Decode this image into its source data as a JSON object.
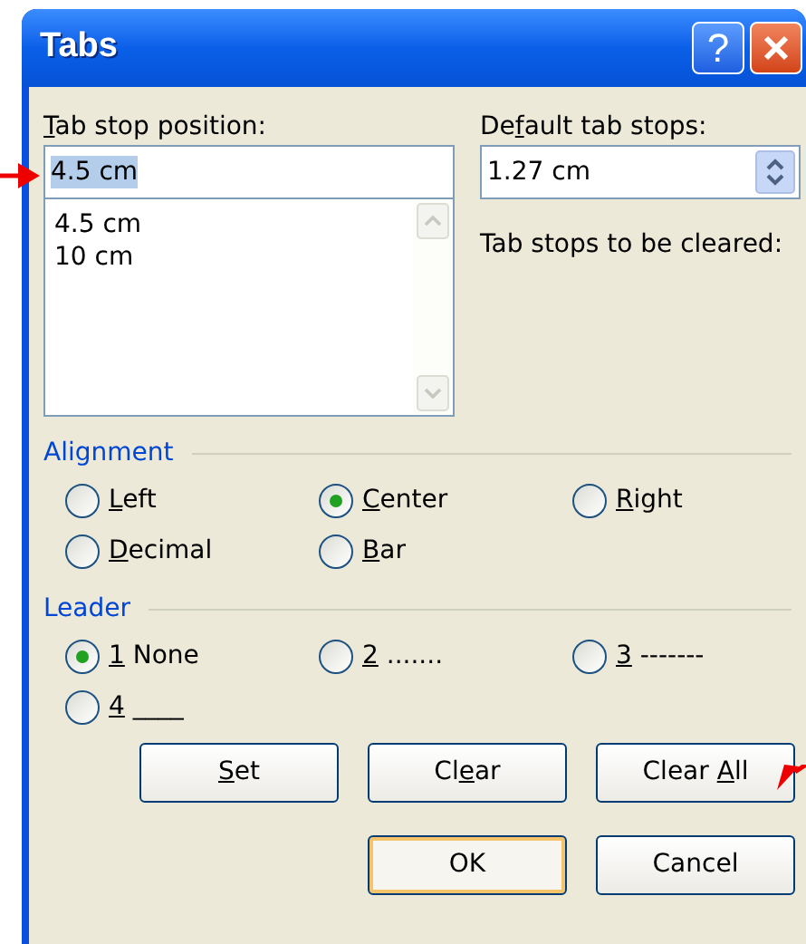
{
  "window": {
    "title": "Tabs",
    "buttons": [
      {
        "kind": "help",
        "label": "?"
      },
      {
        "kind": "close"
      }
    ]
  },
  "tab_stop_position": {
    "label": {
      "key": "T",
      "post": "ab stop position:"
    },
    "value": "4.5 cm",
    "list": [
      "4.5 cm",
      "10 cm"
    ]
  },
  "default_tab_stops": {
    "label": {
      "pre": "De",
      "key": "f",
      "post": "ault tab stops:"
    },
    "value": "1.27 cm"
  },
  "tab_stops_to_be_cleared": {
    "label": "Tab stops to be cleared:"
  },
  "alignment": {
    "title": "Alignment",
    "options": [
      {
        "label": {
          "key": "L",
          "post": "eft"
        },
        "selected": false
      },
      {
        "label": {
          "key": "C",
          "post": "enter"
        },
        "selected": true
      },
      {
        "label": {
          "key": "R",
          "post": "ight"
        },
        "selected": false
      },
      {
        "label": {
          "key": "D",
          "post": "ecimal"
        },
        "selected": false
      },
      {
        "label": {
          "key": "B",
          "post": "ar"
        },
        "selected": false
      }
    ]
  },
  "leader": {
    "title": "Leader",
    "options": [
      {
        "label": {
          "key": "1",
          "post": " None"
        },
        "selected": true
      },
      {
        "label": {
          "key": "2",
          "post": " ......."
        },
        "selected": false
      },
      {
        "label": {
          "key": "3",
          "post": " -------"
        },
        "selected": false
      },
      {
        "label": {
          "key": "4",
          "post": " ____"
        },
        "selected": false
      }
    ]
  },
  "buttons": [
    {
      "label": {
        "key": "S",
        "post": "et"
      },
      "default": false
    },
    {
      "label": {
        "pre": "Cl",
        "key": "e",
        "post": "ar"
      },
      "default": false
    },
    {
      "label": {
        "pre": "Clear ",
        "key": "A",
        "post": "ll"
      },
      "default": false
    },
    {
      "label": {
        "pre": "OK"
      },
      "default": true
    },
    {
      "label": {
        "pre": "Cancel"
      },
      "default": false
    }
  ]
}
